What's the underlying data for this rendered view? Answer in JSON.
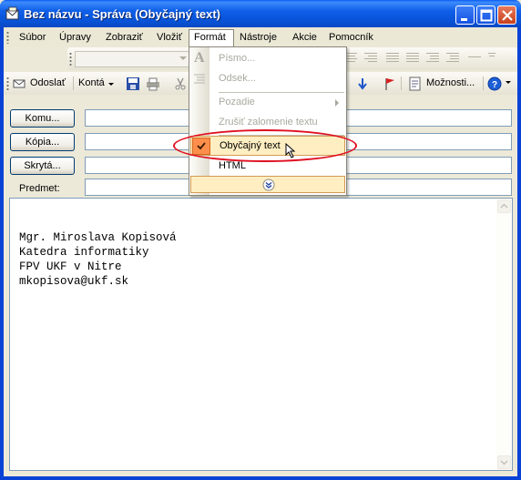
{
  "window": {
    "title": "Bez názvu - Správa (Obyčajný text)"
  },
  "menubar": {
    "items": [
      {
        "label": "Súbor"
      },
      {
        "label": "Úpravy"
      },
      {
        "label": "Zobraziť"
      },
      {
        "label": "Vložiť"
      },
      {
        "label": "Formát"
      },
      {
        "label": "Nástroje"
      },
      {
        "label": "Akcie"
      },
      {
        "label": "Pomocník"
      }
    ],
    "active": "Formát"
  },
  "format_menu": {
    "items": [
      {
        "label": "Písmo...",
        "enabled": false,
        "icon": "font-a-icon"
      },
      {
        "label": "Odsek...",
        "enabled": false,
        "icon": "paragraph-icon"
      },
      {
        "label": "Pozadie",
        "enabled": false,
        "submenu": true
      },
      {
        "label": "Zrušiť zalomenie textu",
        "enabled": false
      },
      {
        "label": "Obyčajný text",
        "enabled": true,
        "checked": true,
        "highlighted": true
      },
      {
        "label": "HTML",
        "enabled": true
      }
    ],
    "expand_icon": "double-chevron-down-icon"
  },
  "toolbar": {
    "send_label": "Odoslať",
    "accounts_label": "Kontá",
    "options_label": "Možnosti..."
  },
  "header": {
    "to_label": "Komu...",
    "cc_label": "Kópia...",
    "bcc_label": "Skrytá...",
    "subject_label": "Predmet:",
    "to_value": "",
    "cc_value": "",
    "bcc_value": "",
    "subject_value": ""
  },
  "body": {
    "lines": [
      "Mgr. Miroslava Kopisová",
      "Katedra informatiky",
      "FPV UKF v Nitre",
      "mkopisova@ukf.sk"
    ]
  },
  "colors": {
    "titlebar": "#0752d6",
    "menu_highlight": "#ffeec2",
    "check_bg": "#fe8e4b",
    "annotation": "#e01020"
  }
}
